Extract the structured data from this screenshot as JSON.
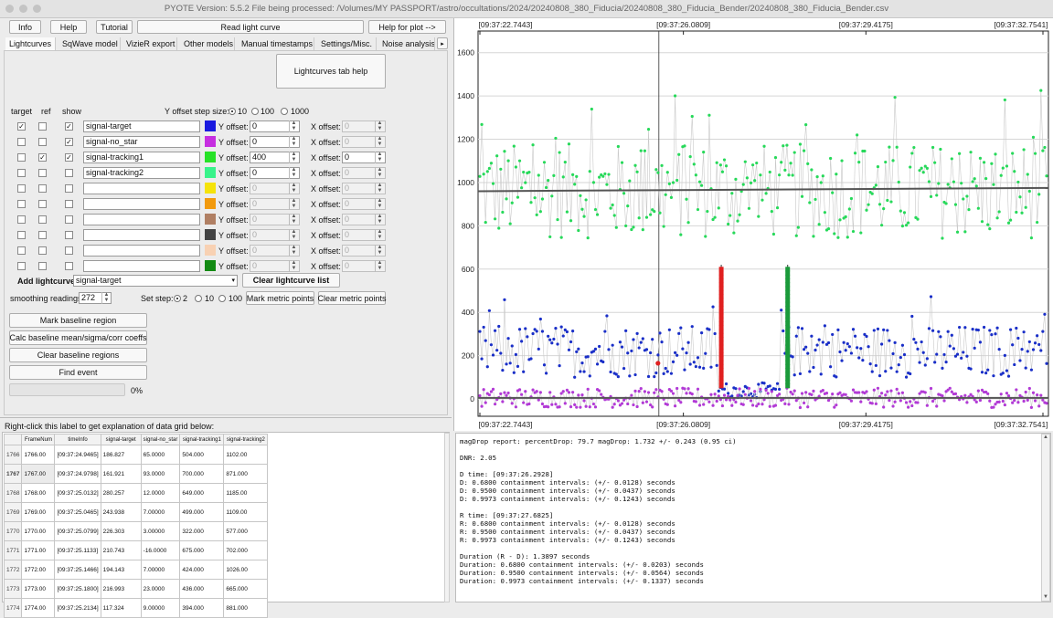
{
  "window_title": "PYOTE Version: 5.5.2  File being processed: /Volumes/MY PASSPORT/astro/occultations/2024/20240808_380_Fiducia/20240808_380_Fiducia_Bender/20240808_380_Fiducia_Bender.csv",
  "toolbar": {
    "info": "Info",
    "help": "Help",
    "tutorial": "Tutorial",
    "read_light_curve": "Read light curve",
    "help_for_plot": "Help for plot -->"
  },
  "tabs": [
    "Lightcurves",
    "SqWave model",
    "VizieR export",
    "Other models",
    "Manual timestamps",
    "Settings/Misc.",
    "Noise analysis/"
  ],
  "lightcurves_tab_help": "Lightcurves tab help",
  "col_headers": {
    "target": "target",
    "ref": "ref",
    "show": "show"
  },
  "y_step": {
    "label": "Y offset step size:",
    "options": [
      "10",
      "100",
      "1000"
    ],
    "selected": "10"
  },
  "curves": [
    {
      "name": "signal-target",
      "target": true,
      "ref": false,
      "show": true,
      "color": "#1a1adf",
      "yoff": "0",
      "xoff": "0",
      "enabled": true,
      "xenabled": false
    },
    {
      "name": "signal-no_star",
      "target": false,
      "ref": false,
      "show": true,
      "color": "#c62ee0",
      "yoff": "0",
      "xoff": "0",
      "enabled": true,
      "xenabled": false
    },
    {
      "name": "signal-tracking1",
      "target": false,
      "ref": true,
      "show": true,
      "color": "#27e227",
      "yoff": "400",
      "xoff": "0",
      "enabled": true,
      "xenabled": true
    },
    {
      "name": "signal-tracking2",
      "target": false,
      "ref": false,
      "show": false,
      "color": "#38f38a",
      "yoff": "0",
      "xoff": "0",
      "enabled": true,
      "xenabled": false
    },
    {
      "name": "",
      "target": false,
      "ref": false,
      "show": false,
      "color": "#f5e30a",
      "yoff": "0",
      "xoff": "0",
      "enabled": false,
      "xenabled": false
    },
    {
      "name": "",
      "target": false,
      "ref": false,
      "show": false,
      "color": "#f29a0d",
      "yoff": "0",
      "xoff": "0",
      "enabled": false,
      "xenabled": false
    },
    {
      "name": "",
      "target": false,
      "ref": false,
      "show": false,
      "color": "#b07f63",
      "yoff": "0",
      "xoff": "0",
      "enabled": false,
      "xenabled": false
    },
    {
      "name": "",
      "target": false,
      "ref": false,
      "show": false,
      "color": "#444444",
      "yoff": "0",
      "xoff": "0",
      "enabled": false,
      "xenabled": false
    },
    {
      "name": "",
      "target": false,
      "ref": false,
      "show": false,
      "color": "#f8d1b3",
      "yoff": "0",
      "xoff": "0",
      "enabled": false,
      "xenabled": false
    },
    {
      "name": "",
      "target": false,
      "ref": false,
      "show": false,
      "color": "#138a13",
      "yoff": "0",
      "xoff": "0",
      "enabled": false,
      "xenabled": false
    }
  ],
  "y_offset_label": "Y offset:",
  "x_offset_label": "X offset:",
  "add_lightcurve_label": "Add lightcurve",
  "add_lightcurve_value": "signal-target",
  "clear_lightcurve_list": "Clear lightcurve list",
  "smoothing_label": "smoothing readings",
  "smoothing_value": "272",
  "set_step": {
    "label": "Set step:",
    "options": [
      "2",
      "10",
      "100"
    ],
    "selected": "2"
  },
  "mark_metric_points": "Mark metric points",
  "clear_metric_points": "Clear metric points",
  "buttons_left": [
    "Mark baseline region",
    "Calc baseline mean/sigma/corr coeffs",
    "Clear baseline regions",
    "Find event"
  ],
  "progress_percent": "0%",
  "progress_value": 0,
  "grid_label": "Right-click this label to get explanation of data grid below:",
  "grid": {
    "headers": [
      "FrameNum",
      "timeInfo",
      "signal-target",
      "signal-no_star",
      "signal-tracking1",
      "signal-tracking2"
    ],
    "rows": [
      [
        "1766",
        "1766.00",
        "[09:37:24.9465]",
        "186.827",
        "65.0000",
        "504.000",
        "1102.00"
      ],
      [
        "1767",
        "1767.00",
        "[09:37:24.9798]",
        "161.921",
        "93.0000",
        "700.000",
        "871.000"
      ],
      [
        "1768",
        "1768.00",
        "[09:37:25.0132]",
        "280.257",
        "12.0000",
        "649.000",
        "1185.00"
      ],
      [
        "1769",
        "1769.00",
        "[09:37:25.0465]",
        "243.938",
        "7.00000",
        "499.000",
        "1109.00"
      ],
      [
        "1770",
        "1770.00",
        "[09:37:25.0799]",
        "226.303",
        "3.00000",
        "322.000",
        "577.000"
      ],
      [
        "1771",
        "1771.00",
        "[09:37:25.1133]",
        "210.743",
        "-16.0000",
        "675.000",
        "702.000"
      ],
      [
        "1772",
        "1772.00",
        "[09:37:25.1466]",
        "194.143",
        "7.00000",
        "424.000",
        "1026.00"
      ],
      [
        "1773",
        "1773.00",
        "[09:37:25.1800]",
        "216.993",
        "23.0000",
        "436.000",
        "665.000"
      ],
      [
        "1774",
        "1774.00",
        "[09:37:25.2134]",
        "117.324",
        "9.00000",
        "394.000",
        "881.000"
      ]
    ]
  },
  "report_lines": [
    "magDrop report: percentDrop: 79.7 magDrop: 1.732 +/- 0.243 (0.95 ci)",
    "",
    "DNR: 2.05",
    "",
    "D time: [09:37:26.2928]",
    "D: 0.6800 containment intervals: (+/- 0.0128) seconds",
    "D: 0.9500 containment intervals: (+/- 0.0437) seconds",
    "D: 0.9973 containment intervals: (+/- 0.1243) seconds",
    "",
    "R time: [09:37:27.6825]",
    "R: 0.6800 containment intervals: (+/- 0.0128) seconds",
    "R: 0.9500 containment intervals: (+/- 0.0437) seconds",
    "R: 0.9973 containment intervals: (+/- 0.1243) seconds",
    "",
    "Duration (R - D): 1.3897 seconds",
    "Duration: 0.6800 containment intervals: (+/- 0.0203) seconds",
    "Duration: 0.9500 containment intervals: (+/- 0.0564) seconds",
    "Duration: 0.9973 containment intervals: (+/- 0.1337) seconds"
  ],
  "chart_data": {
    "type": "scatter",
    "ylim": [
      -80,
      1700
    ],
    "yticks": [
      "0",
      "200",
      "400",
      "600",
      "800",
      "1000",
      "1200",
      "1400",
      "1600"
    ],
    "xticks": [
      "[09:37:22.7443]",
      "[09:37:26.0809]",
      "[09:37:29.4175]",
      "[09:37:32.7541]"
    ],
    "grid": true,
    "series": [
      {
        "name": "signal-tracking1",
        "color": "#27d95a",
        "baseline": 960
      },
      {
        "name": "signal-target",
        "color": "#1a2fc8",
        "baseline": 220
      },
      {
        "name": "signal-no_star",
        "color": "#b23ad6",
        "baseline": 5
      }
    ],
    "d_marker_color": "#e02020",
    "r_marker_color": "#1a9a3a"
  }
}
